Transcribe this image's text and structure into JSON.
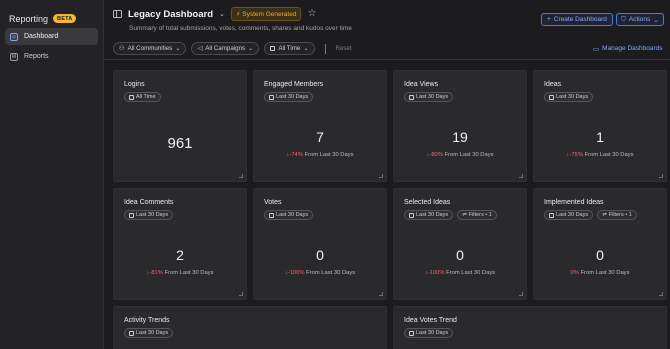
{
  "sidebar": {
    "brand": "Reporting",
    "beta": "BETA",
    "items": [
      {
        "label": "Dashboard",
        "icon": "dashboard-icon"
      },
      {
        "label": "Reports",
        "icon": "reports-icon"
      }
    ]
  },
  "header": {
    "title": "Legacy Dashboard",
    "badge": "System Generated",
    "subtitle": "Summary of total submissions, votes, comments, shares and kudos over time",
    "create_label": "Create Dashboard",
    "actions_label": "Actions"
  },
  "filters": {
    "communities": "All Communities",
    "campaigns": "All Campaigns",
    "time": "All Time",
    "reset": "Reset",
    "manage": "Manage Dashboards"
  },
  "cards": [
    {
      "title": "Logins",
      "range": "All Time",
      "value": "961"
    },
    {
      "title": "Engaged Members",
      "range": "Last 30 Days",
      "value": "7",
      "delta": "↓-74%",
      "delta_suffix": " From Last 30 Days"
    },
    {
      "title": "Idea Views",
      "range": "Last 30 Days",
      "value": "19",
      "delta": "↓-80%",
      "delta_suffix": " From Last 30 Days"
    },
    {
      "title": "Ideas",
      "range": "Last 30 Days",
      "value": "1",
      "delta": "↓-75%",
      "delta_suffix": " From Last 30 Days"
    },
    {
      "title": "Idea Comments",
      "range": "Last 30 Days",
      "value": "2",
      "delta": "↓-81%",
      "delta_suffix": " From Last 30 Days"
    },
    {
      "title": "Votes",
      "range": "Last 30 Days",
      "value": "0",
      "delta": "↓-100%",
      "delta_suffix": " From Last 30 Days"
    },
    {
      "title": "Selected Ideas",
      "range": "Last 30 Days",
      "filter": "Filters • 1",
      "value": "0",
      "delta": "↓-100%",
      "delta_suffix": " From Last 30 Days"
    },
    {
      "title": "Implemented Ideas",
      "range": "Last 30 Days",
      "filter": "Filters • 1",
      "value": "0",
      "delta": "0%",
      "delta_suffix": " From Last 30 Days"
    }
  ],
  "bottom_cards": [
    {
      "title": "Activity Trends",
      "range": "Last 30 Days"
    },
    {
      "title": "Idea Votes Trend",
      "range": "Last 30 Days"
    }
  ],
  "colors": {
    "accent": "#7fa7ff",
    "negative": "#ee6a6a",
    "badge": "#e8a93a"
  }
}
